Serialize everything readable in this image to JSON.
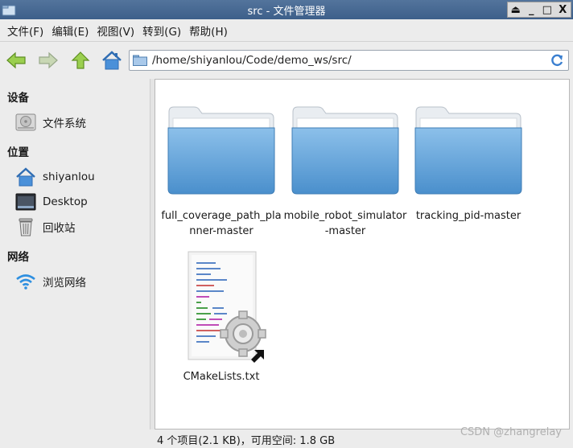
{
  "window": {
    "title": "src - 文件管理器",
    "controls": [
      "⏏",
      "_",
      "□",
      "X"
    ]
  },
  "menu": [
    {
      "label": "文件(F)"
    },
    {
      "label": "编辑(E)"
    },
    {
      "label": "视图(V)"
    },
    {
      "label": "转到(G)"
    },
    {
      "label": "帮助(H)"
    }
  ],
  "location": {
    "path": "/home/shiyanlou/Code/demo_ws/src/"
  },
  "sidebar": {
    "devices_heading": "设备",
    "devices": [
      {
        "label": "文件系统",
        "icon": "harddisk-icon"
      }
    ],
    "places_heading": "位置",
    "places": [
      {
        "label": "shiyanlou",
        "icon": "home-icon"
      },
      {
        "label": "Desktop",
        "icon": "desktop-icon"
      },
      {
        "label": "回收站",
        "icon": "trash-icon"
      }
    ],
    "network_heading": "网络",
    "network": [
      {
        "label": "浏览网络",
        "icon": "wifi-icon"
      }
    ]
  },
  "files": [
    {
      "name": "full_coverage_path_planner-master",
      "type": "folder"
    },
    {
      "name": "mobile_robot_simulator-master",
      "type": "folder"
    },
    {
      "name": "tracking_pid-master",
      "type": "folder"
    },
    {
      "name": "CMakeLists.txt",
      "type": "text-file"
    }
  ],
  "status": {
    "text": "4 个项目(2.1 KB)，可用空间: 1.8 GB"
  },
  "watermark": "CSDN @zhangrelay",
  "colors": {
    "titlebar": "#3d5f8a",
    "folder": "#5a9fd8",
    "nav_arrow": "#8cc63f"
  }
}
